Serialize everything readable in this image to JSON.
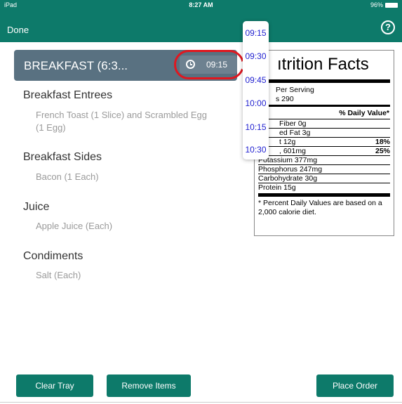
{
  "status_bar": {
    "carrier": "iPad",
    "time": "8:27 AM",
    "battery": "96%"
  },
  "nav": {
    "done_label": "Done",
    "help_label": "?"
  },
  "meal": {
    "title": "BREAKFAST (6:3...",
    "time": "09:15"
  },
  "sections": [
    {
      "title": "Breakfast Entrees",
      "items": [
        "French Toast (1 Slice) and Scrambled Egg",
        "(1 Egg)"
      ]
    },
    {
      "title": "Breakfast Sides",
      "items": [
        "Bacon (1 Each)"
      ]
    },
    {
      "title": "Juice",
      "items": [
        "Apple Juice (Each)"
      ]
    },
    {
      "title": "Condiments",
      "items": [
        "Salt (Each)"
      ]
    }
  ],
  "nutrition": {
    "title": "ıtrition Facts",
    "serving": "Per Serving",
    "calories": "s 290",
    "dv_header": "% Daily Value*",
    "rows": [
      {
        "label": "Fiber 0g",
        "pct": ""
      },
      {
        "label": "ed Fat 3g",
        "pct": ""
      },
      {
        "label": "t 12g",
        "pct": "18%"
      },
      {
        "label": ", 601mg",
        "pct": "25%"
      },
      {
        "label": "Potassium 377mg",
        "pct": ""
      },
      {
        "label": "Phosphorus 247mg",
        "pct": ""
      },
      {
        "label": "Carbohydrate 30g",
        "pct": ""
      },
      {
        "label": "Protein 15g",
        "pct": ""
      }
    ],
    "footnote": "* Percent Daily Values are based on a 2,000 calorie diet."
  },
  "time_options": [
    "09:15",
    "09:30",
    "09:45",
    "10:00",
    "10:15",
    "10:30"
  ],
  "buttons": {
    "clear": "Clear Tray",
    "remove": "Remove Items",
    "place": "Place Order"
  },
  "colors": {
    "teal": "#0d7a6a",
    "header": "#597181",
    "highlight": "#e0171f",
    "option_text": "#1f1fd0"
  }
}
